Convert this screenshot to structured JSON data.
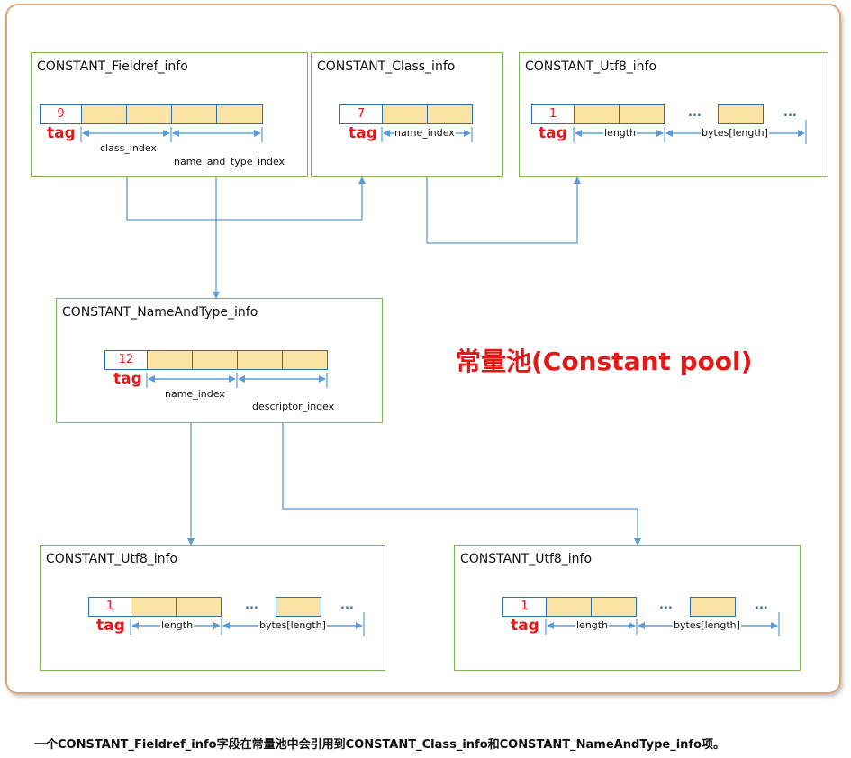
{
  "boxes": {
    "fieldref": {
      "title": "CONSTANT_Fieldref_info",
      "tag_value": "9",
      "tag_label": "tag",
      "label_1": "class_index",
      "label_2": "name_and_type_index"
    },
    "class": {
      "title": "CONSTANT_Class_info",
      "tag_value": "7",
      "tag_label": "tag",
      "label_1": "name_index"
    },
    "utf8_top": {
      "title": "CONSTANT_Utf8_info",
      "tag_value": "1",
      "tag_label": "tag",
      "label_1": "length",
      "label_2": "bytes[length]",
      "ellipsis": "..."
    },
    "nameandtype": {
      "title": "CONSTANT_NameAndType_info",
      "tag_value": "12",
      "tag_label": "tag",
      "label_1": "name_index",
      "label_2": "descriptor_index"
    },
    "utf8_left": {
      "title": "CONSTANT_Utf8_info",
      "tag_value": "1",
      "tag_label": "tag",
      "label_1": "length",
      "label_2": "bytes[length]",
      "ellipsis": "..."
    },
    "utf8_right": {
      "title": "CONSTANT_Utf8_info",
      "tag_value": "1",
      "tag_label": "tag",
      "label_1": "length",
      "label_2": "bytes[length]",
      "ellipsis": "..."
    }
  },
  "pool_title": "常量池(Constant pool)",
  "caption": "一个CONSTANT_Fieldref_info字段在常量池中会引用到CONSTANT_Class_info和CONSTANT_NameAndType_info项。",
  "colors": {
    "border_green": "#7fb65a",
    "field_fill": "#fbe3a4",
    "field_border": "#2e6fb3",
    "arrow": "#5b9bd5",
    "red": "#e31818",
    "frame": "#d9a779"
  }
}
